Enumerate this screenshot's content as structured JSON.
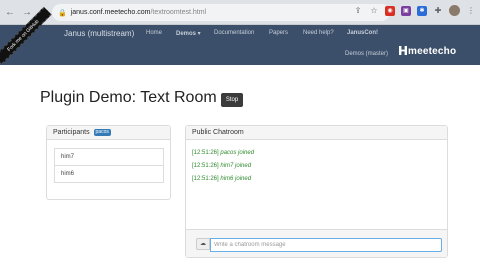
{
  "browser": {
    "back_glyph": "←",
    "forward_glyph": "→",
    "reload_glyph": "⟳",
    "lock_glyph": "🔒",
    "url_host": "janus.conf.meetecho.com",
    "url_path": "/textroomtest.html",
    "icons": [
      "share-icon",
      "star-icon",
      "extension-icons",
      "puzzle-icon",
      "profile-avatar",
      "menu-icon"
    ]
  },
  "navbar": {
    "brand": "Janus (multistream)",
    "links": {
      "home": "Home",
      "demos": "Demos ▾",
      "documentation": "Documentation",
      "papers": "Papers",
      "help": "Need help?",
      "janusconf": "JanusCon!"
    },
    "demos_master": "Demos (master)",
    "logo_text": "meetecho",
    "ribbon": "Fork me on GitHub"
  },
  "page": {
    "title": "Plugin Demo: Text Room",
    "stop_label": "Stop"
  },
  "participants": {
    "header": "Participants",
    "badge": "pacos",
    "items": [
      "him7",
      "him6"
    ]
  },
  "chatroom": {
    "header": "Public Chatroom",
    "messages": [
      {
        "time": "[12:51:26]",
        "text": "pacos joined"
      },
      {
        "time": "[12:51:26]",
        "text": "him7 joined"
      },
      {
        "time": "[12:51:26]",
        "text": "him6 joined"
      }
    ],
    "input_placeholder": "Write a chatroom message",
    "input_value": ""
  },
  "colors": {
    "navbar_bg": "#3c4f6a",
    "join_text": "#2e8b2e",
    "badge_bg": "#337ab7"
  }
}
